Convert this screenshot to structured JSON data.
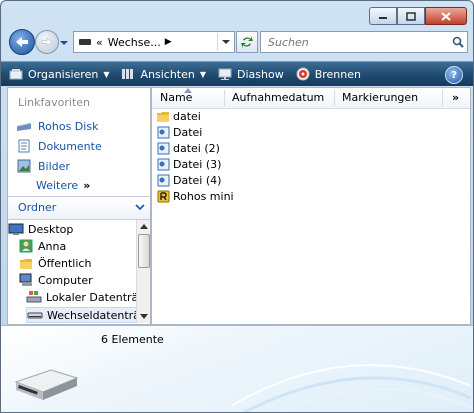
{
  "window": {
    "caption_buttons": [
      "minimize-icon",
      "maximize-icon",
      "close-icon"
    ]
  },
  "nav": {
    "address_crumb": "Wechse...",
    "search_placeholder": "Suchen"
  },
  "commandbar": {
    "items": [
      {
        "label": "Organisieren",
        "icon": "organize-icon",
        "dropdown": true
      },
      {
        "label": "Ansichten",
        "icon": "views-icon",
        "dropdown": true
      },
      {
        "label": "Diashow",
        "icon": "slideshow-icon",
        "dropdown": false
      },
      {
        "label": "Brennen",
        "icon": "burn-icon",
        "dropdown": false
      }
    ],
    "help_label": "?"
  },
  "navpane": {
    "favorites_header": "Linkfavoriten",
    "favorites": [
      {
        "label": "Rohos Disk",
        "icon": "disk-icon"
      },
      {
        "label": "Dokumente",
        "icon": "documents-icon"
      },
      {
        "label": "Bilder",
        "icon": "pictures-icon"
      }
    ],
    "more_label": "Weitere",
    "more_glyph": "»",
    "folders_header": "Ordner",
    "tree": [
      {
        "label": "Desktop",
        "icon": "desktop-icon",
        "indent": 0
      },
      {
        "label": "Anna",
        "icon": "user-icon",
        "indent": 1
      },
      {
        "label": "Öffentlich",
        "icon": "folder-icon",
        "indent": 1
      },
      {
        "label": "Computer",
        "icon": "computer-icon",
        "indent": 1
      },
      {
        "label": "Lokaler Datenträge",
        "icon": "local-drive-icon",
        "indent": 2
      },
      {
        "label": "Wechseldatenträg",
        "icon": "removable-drive-icon",
        "indent": 2,
        "selected": true
      }
    ]
  },
  "filepane": {
    "columns": [
      "Name",
      "Aufnahmedatum",
      "Markierungen"
    ],
    "more_columns_glyph": "»",
    "files": [
      {
        "name": "datei",
        "icon": "folder-icon"
      },
      {
        "name": "Datei",
        "icon": "file-icon"
      },
      {
        "name": "datei (2)",
        "icon": "file-icon"
      },
      {
        "name": "Datei (3)",
        "icon": "file-icon"
      },
      {
        "name": "Datei (4)",
        "icon": "file-icon"
      },
      {
        "name": "Rohos mini",
        "icon": "rohos-app-icon"
      }
    ]
  },
  "details": {
    "count": "6 Elemente"
  },
  "colors": {
    "commandbar": "#1f4a70",
    "link": "#1b52a8",
    "accent": "#2457a7"
  }
}
